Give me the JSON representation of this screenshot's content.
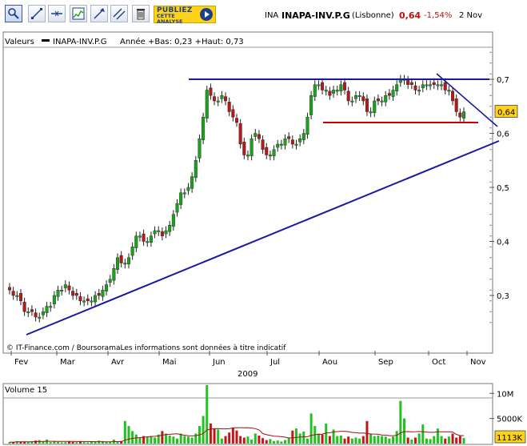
{
  "toolbar": {
    "buttons": [
      "zoom-icon",
      "draw-line-icon",
      "horizontal-line-icon",
      "indicator-icon",
      "trend-arrow-icon",
      "parallel-lines-icon",
      "delete-icon"
    ],
    "publiez_line1": "PUBLIEZ",
    "publiez_line2": "CETTE ANALYSE"
  },
  "ticker": {
    "market": "INA",
    "name": "INAPA-INV.P.G",
    "exchange": "(Lisbonne)",
    "price": "0,64",
    "change": "-1,54%",
    "date": "2 Nov"
  },
  "colors": {
    "up": "#1aa31a",
    "down": "#b51a1a",
    "trendline": "#1a1aa0",
    "support": "#cc0000",
    "price_tag": "#ffd21a"
  },
  "legend": {
    "left": "Valeurs",
    "series": "INAPA-INV.P.G",
    "stats": "Année +Bas: 0,23 +Haut: 0,73"
  },
  "chart_data": {
    "type": "candlestick",
    "ylim": [
      0.22,
      0.78
    ],
    "y_ticks": [
      "0,7",
      "0,6",
      "0,5",
      "0,4",
      "0,3"
    ],
    "y_tick_values": [
      0.7,
      0.6,
      0.5,
      0.4,
      0.3
    ],
    "x_ticks": [
      "Fev",
      "Mar",
      "Avr",
      "Mai",
      "Jun",
      "Jul",
      "Aou",
      "Sep",
      "Oct",
      "Nov"
    ],
    "year_label": "2009",
    "last_price_label": "0,64",
    "attribution": "© IT-Finance.com / BoursoramaLes informations sont données à titre indicatif",
    "trend_lines": [
      {
        "kind": "resistance",
        "from": [
          0.0,
          0.7
        ],
        "to": [
          1.0,
          0.7
        ]
      },
      {
        "kind": "support",
        "from": [
          0.0,
          0.62
        ],
        "to": [
          1.0,
          0.62
        ]
      },
      {
        "kind": "rising",
        "from": [
          0.0,
          0.235
        ],
        "to": [
          1.0,
          0.58
        ]
      },
      {
        "kind": "falling",
        "from": [
          0.0,
          0.71
        ],
        "to": [
          1.0,
          0.61
        ]
      }
    ],
    "closes": [
      0.31,
      0.3,
      0.3,
      0.29,
      0.27,
      0.27,
      0.27,
      0.26,
      0.26,
      0.27,
      0.28,
      0.28,
      0.3,
      0.31,
      0.31,
      0.32,
      0.31,
      0.3,
      0.3,
      0.29,
      0.29,
      0.29,
      0.29,
      0.3,
      0.3,
      0.31,
      0.32,
      0.33,
      0.35,
      0.37,
      0.36,
      0.36,
      0.37,
      0.39,
      0.41,
      0.41,
      0.4,
      0.4,
      0.41,
      0.42,
      0.42,
      0.41,
      0.42,
      0.43,
      0.45,
      0.47,
      0.49,
      0.49,
      0.5,
      0.52,
      0.55,
      0.59,
      0.63,
      0.68,
      0.67,
      0.66,
      0.66,
      0.67,
      0.66,
      0.64,
      0.63,
      0.62,
      0.58,
      0.56,
      0.56,
      0.59,
      0.6,
      0.59,
      0.57,
      0.56,
      0.56,
      0.57,
      0.58,
      0.58,
      0.59,
      0.59,
      0.58,
      0.58,
      0.59,
      0.6,
      0.63,
      0.67,
      0.69,
      0.69,
      0.68,
      0.68,
      0.67,
      0.68,
      0.68,
      0.69,
      0.68,
      0.66,
      0.66,
      0.67,
      0.67,
      0.66,
      0.64,
      0.64,
      0.66,
      0.66,
      0.66,
      0.67,
      0.67,
      0.68,
      0.69,
      0.7,
      0.7,
      0.69,
      0.69,
      0.68,
      0.68,
      0.69,
      0.69,
      0.69,
      0.69,
      0.69,
      0.69,
      0.68,
      0.68,
      0.66,
      0.64,
      0.63,
      0.64
    ],
    "volume": {
      "label": "Volume 15",
      "y_ticks": [
        "10M",
        "5000K"
      ],
      "y_tick_values": [
        10000000,
        5000000
      ],
      "last_label": "1113K",
      "max": 13000000,
      "values": [
        300000,
        250000,
        500000,
        400000,
        350000,
        300000,
        450000,
        600000,
        700000,
        500000,
        800000,
        300000,
        400000,
        350000,
        250000,
        300000,
        400000,
        350000,
        300000,
        400000,
        300000,
        250000,
        350000,
        400000,
        600000,
        500000,
        300000,
        350000,
        800000,
        400000,
        500000,
        4500000,
        3500000,
        2500000,
        1800000,
        1200000,
        1500000,
        1300000,
        1500000,
        1200000,
        1800000,
        2500000,
        2000000,
        1600000,
        1400000,
        1000000,
        2000000,
        1500000,
        1400000,
        1200000,
        2000000,
        3500000,
        5500000,
        12000000,
        4000000,
        3000000,
        2800000,
        1000000,
        1500000,
        2200000,
        3200000,
        2600000,
        1500000,
        1200000,
        1400000,
        800000,
        2000000,
        1600000,
        1100000,
        700000,
        900000,
        500000,
        600000,
        400000,
        700000,
        1100000,
        2600000,
        3000000,
        2000000,
        2400000,
        1000000,
        6000000,
        3500000,
        2000000,
        1800000,
        4000000,
        1500000,
        2800000,
        1500000,
        1600000,
        1000000,
        1400000,
        1000000,
        1200000,
        1000000,
        1500000,
        4500000,
        2000000,
        1500000,
        1600000,
        1500000,
        1400000,
        1000000,
        1400000,
        2500000,
        8500000,
        5000000,
        1200000,
        800000,
        1200000,
        2000000,
        3800000,
        1000000,
        900000,
        1500000,
        3000000,
        1500000,
        1000000,
        1400000,
        2000000,
        1200000,
        1500000,
        1113000
      ]
    }
  }
}
